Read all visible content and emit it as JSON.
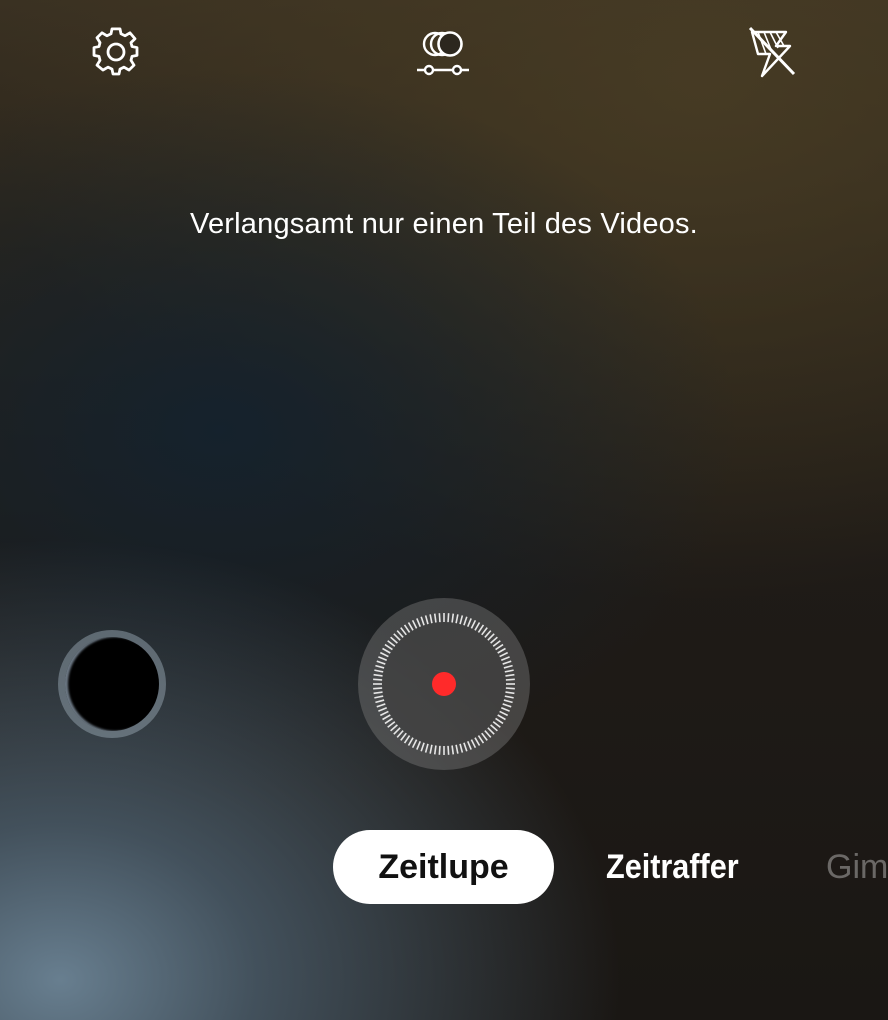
{
  "top_bar": {
    "settings_icon": "gear-icon",
    "effects_icon": "overlapping-circles-slider-icon",
    "flash_icon": "flash-off-icon"
  },
  "hint_text": "Verlangsamt nur einen Teil des Videos.",
  "controls": {
    "gallery_icon": "gallery-thumbnail",
    "shutter_icon": "record-button",
    "record_dot_color": "#ff2a2a"
  },
  "modes": {
    "active": "Zeitlupe",
    "items": [
      "Zeitlupe",
      "Zeitraffer",
      "Gimb"
    ]
  }
}
